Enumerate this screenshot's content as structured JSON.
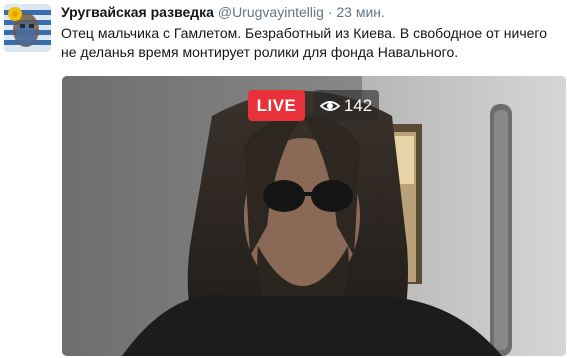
{
  "tweet": {
    "display_name": "Уругвайская разведка",
    "handle": "@Urugvayintellig",
    "separator": "·",
    "time": "23 мин.",
    "text_line_1": "Отец мальчика с Гамлетом. Безработный из Киева. В свободное от ничего",
    "text_line_2": "не деланья время монтирует ролики для фонда Навального."
  },
  "video": {
    "live_label": "LIVE",
    "viewer_count": "142",
    "viewer_icon": "eye-icon"
  },
  "colors": {
    "live_red": "#e8313a",
    "name_text": "#14171a",
    "meta_text": "#657786"
  }
}
